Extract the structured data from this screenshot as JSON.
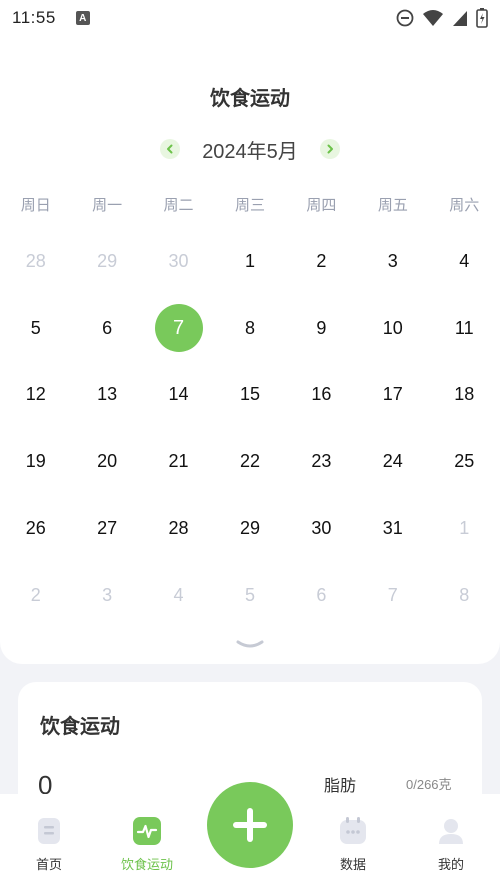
{
  "status_bar": {
    "time": "11:55",
    "a_badge": "A"
  },
  "page": {
    "title": "饮食运动"
  },
  "calendar": {
    "month_label": "2024年5月",
    "weekdays": [
      "周日",
      "周一",
      "周二",
      "周三",
      "周四",
      "周五",
      "周六"
    ],
    "weeks": [
      [
        {
          "d": "28",
          "m": true
        },
        {
          "d": "29",
          "m": true
        },
        {
          "d": "30",
          "m": true
        },
        {
          "d": "1"
        },
        {
          "d": "2"
        },
        {
          "d": "3"
        },
        {
          "d": "4"
        }
      ],
      [
        {
          "d": "5"
        },
        {
          "d": "6"
        },
        {
          "d": "7",
          "s": true
        },
        {
          "d": "8"
        },
        {
          "d": "9"
        },
        {
          "d": "10"
        },
        {
          "d": "11"
        }
      ],
      [
        {
          "d": "12"
        },
        {
          "d": "13"
        },
        {
          "d": "14"
        },
        {
          "d": "15"
        },
        {
          "d": "16"
        },
        {
          "d": "17"
        },
        {
          "d": "18"
        }
      ],
      [
        {
          "d": "19"
        },
        {
          "d": "20"
        },
        {
          "d": "21"
        },
        {
          "d": "22"
        },
        {
          "d": "23"
        },
        {
          "d": "24"
        },
        {
          "d": "25"
        }
      ],
      [
        {
          "d": "26"
        },
        {
          "d": "27"
        },
        {
          "d": "28"
        },
        {
          "d": "29"
        },
        {
          "d": "30"
        },
        {
          "d": "31"
        },
        {
          "d": "1",
          "m": true
        }
      ],
      [
        {
          "d": "2",
          "m": true
        },
        {
          "d": "3",
          "m": true
        },
        {
          "d": "4",
          "m": true
        },
        {
          "d": "5",
          "m": true
        },
        {
          "d": "6",
          "m": true
        },
        {
          "d": "7",
          "m": true
        },
        {
          "d": "8",
          "m": true
        }
      ]
    ],
    "selected_day": "7"
  },
  "diet_card": {
    "title": "饮食运动",
    "value": "0",
    "fat_label": "脂肪",
    "fat_value": "0/266克"
  },
  "tabs": [
    {
      "label": "首页",
      "icon": "document-icon"
    },
    {
      "label": "饮食运动",
      "icon": "pulse-icon",
      "active": true
    },
    {
      "label": "数据",
      "icon": "calendar-icon"
    },
    {
      "label": "我的",
      "icon": "person-icon"
    }
  ],
  "colors": {
    "accent": "#79c95b",
    "muted": "#c8ccd6"
  }
}
